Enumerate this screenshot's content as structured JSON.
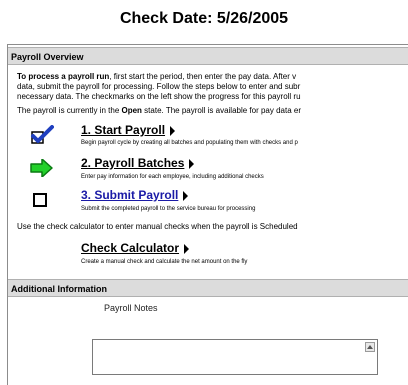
{
  "page": {
    "title": "Check Date: 5/26/2005"
  },
  "overview": {
    "header": "Payroll Overview",
    "intro_bold": "To process a payroll run",
    "intro_line1_rest": ", first start the period, then enter the pay data. After v",
    "intro_line2": "data, submit the payroll for processing. Follow the steps below to enter and subr",
    "intro_line3": "necessary data. The checkmarks on the left show the progress for this payroll ru",
    "status_prefix": "The payroll is currently in the ",
    "status_state": "Open",
    "status_suffix": " state. The payroll is available for pay data er"
  },
  "steps": [
    {
      "icon": "checkmark-icon",
      "label": "1. Start Payroll",
      "description": "Begin payroll cycle by creating all batches and populating them with checks and p"
    },
    {
      "icon": "green-arrow-icon",
      "label": "2. Payroll Batches",
      "description": "Enter pay information for each employee, including additional checks"
    },
    {
      "icon": "empty-checkbox-icon",
      "label": "3. Submit Payroll",
      "description": "Submit the completed payroll to the service bureau for processing"
    }
  ],
  "calculator": {
    "note": "Use the check calculator to enter manual checks when the payroll is Scheduled",
    "label": "Check Calculator",
    "description": "Create a manual check and calculate the net amount on the fly"
  },
  "additional": {
    "header": "Additional Information",
    "notes_label": "Payroll Notes"
  }
}
